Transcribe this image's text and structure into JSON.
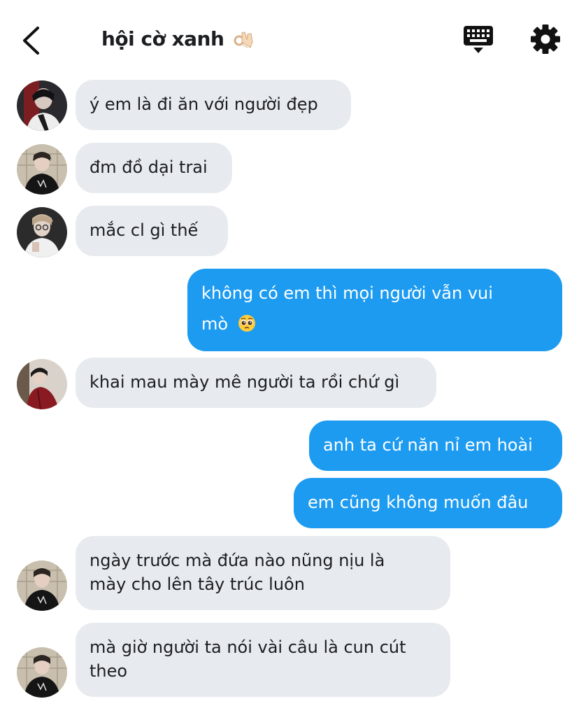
{
  "header": {
    "title": "hội cờ xanh",
    "title_emoji": "ok-hand-emoji"
  },
  "colors": {
    "outgoing_bubble": "#1d9bf0",
    "incoming_bubble": "#e7ebef",
    "text": "#1c1e21"
  },
  "messages": [
    {
      "direction": "in",
      "text": "ý em là đi ăn với người đẹp"
    },
    {
      "direction": "in",
      "text": "đm đồ dại trai"
    },
    {
      "direction": "in",
      "text": "mắc cl gì thế"
    },
    {
      "direction": "out",
      "line1": "không có em thì mọi người vẫn vui",
      "line2": "mò",
      "emoji": "pleading-face-emoji"
    },
    {
      "direction": "in",
      "text": "khai mau mày mê người ta rồi chứ gì"
    },
    {
      "direction": "out",
      "text": "anh ta cứ năn nỉ em hoài"
    },
    {
      "direction": "out",
      "text": "em cũng không muốn đâu"
    },
    {
      "direction": "in",
      "line1": "ngày trước mà đứa nào nũng nịu là",
      "line2": "mày cho lên tây trúc luôn"
    },
    {
      "direction": "in",
      "line1": "mà giờ người ta nói vài câu là cun cút",
      "line2": "theo"
    }
  ]
}
